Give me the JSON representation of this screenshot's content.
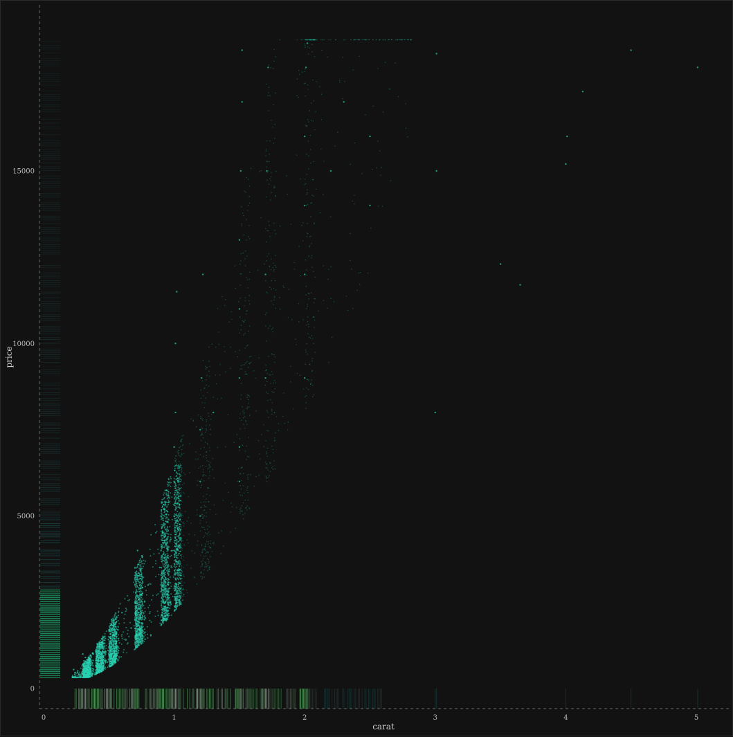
{
  "chart_data": {
    "type": "scatter",
    "title": "",
    "xlabel": "carat",
    "ylabel": "price",
    "xlim": [
      0,
      5.2
    ],
    "ylim": [
      -600,
      18950
    ],
    "x_ticks": [
      0,
      1,
      2,
      3,
      4,
      5
    ],
    "y_ticks": [
      0,
      5000,
      10000,
      15000
    ],
    "grid": false,
    "legend": "none",
    "marginal_rugs": [
      "x-bottom",
      "y-left"
    ],
    "colors": {
      "background": "#121212",
      "point": "#2ad4b2",
      "rug_dense": "#1f9a63",
      "rug_sparse": "#1e5c5a",
      "rug_x": "#5fae6a",
      "axis_line": "#6a6a6a",
      "text": "#bdbdbd"
    },
    "series": [
      {
        "points_sample": [
          [
            0.23,
            326
          ],
          [
            0.23,
            550
          ],
          [
            0.26,
            460
          ],
          [
            0.3,
            500
          ],
          [
            0.3,
            700
          ],
          [
            0.3,
            1000
          ],
          [
            0.31,
            800
          ],
          [
            0.32,
            900
          ],
          [
            0.35,
            800
          ],
          [
            0.38,
            1000
          ],
          [
            0.4,
            1100
          ],
          [
            0.41,
            1300
          ],
          [
            0.5,
            1200
          ],
          [
            0.5,
            1500
          ],
          [
            0.5,
            1700
          ],
          [
            0.52,
            2000
          ],
          [
            0.57,
            1700
          ],
          [
            0.6,
            2200
          ],
          [
            0.7,
            2000
          ],
          [
            0.7,
            2500
          ],
          [
            0.7,
            3000
          ],
          [
            0.7,
            3500
          ],
          [
            0.71,
            2800
          ],
          [
            0.72,
            4000
          ],
          [
            0.8,
            3000
          ],
          [
            0.9,
            3000
          ],
          [
            0.9,
            4000
          ],
          [
            0.9,
            5000
          ],
          [
            0.91,
            4500
          ],
          [
            1.0,
            4000
          ],
          [
            1.0,
            5000
          ],
          [
            1.0,
            6000
          ],
          [
            1.0,
            7000
          ],
          [
            1.01,
            8000
          ],
          [
            1.01,
            10000
          ],
          [
            1.02,
            11500
          ],
          [
            1.2,
            5000
          ],
          [
            1.2,
            6000
          ],
          [
            1.2,
            7500
          ],
          [
            1.21,
            9000
          ],
          [
            1.22,
            12000
          ],
          [
            1.3,
            8000
          ],
          [
            1.5,
            6000
          ],
          [
            1.5,
            7000
          ],
          [
            1.5,
            9000
          ],
          [
            1.5,
            11000
          ],
          [
            1.5,
            13000
          ],
          [
            1.51,
            15000
          ],
          [
            1.52,
            17000
          ],
          [
            1.52,
            18500
          ],
          [
            1.7,
            9000
          ],
          [
            1.7,
            12000
          ],
          [
            1.71,
            15000
          ],
          [
            1.72,
            18000
          ],
          [
            2.0,
            9000
          ],
          [
            2.0,
            12000
          ],
          [
            2.0,
            14000
          ],
          [
            2.0,
            16000
          ],
          [
            2.01,
            18000
          ],
          [
            2.02,
            18700
          ],
          [
            2.2,
            15000
          ],
          [
            2.3,
            17000
          ],
          [
            2.5,
            14000
          ],
          [
            2.5,
            16000
          ],
          [
            3.0,
            8000
          ],
          [
            3.01,
            15000
          ],
          [
            3.01,
            18400
          ],
          [
            3.5,
            12300
          ],
          [
            3.65,
            11700
          ],
          [
            4.0,
            15200
          ],
          [
            4.01,
            16000
          ],
          [
            4.13,
            17300
          ],
          [
            4.5,
            18500
          ],
          [
            5.01,
            18000
          ]
        ]
      }
    ]
  }
}
